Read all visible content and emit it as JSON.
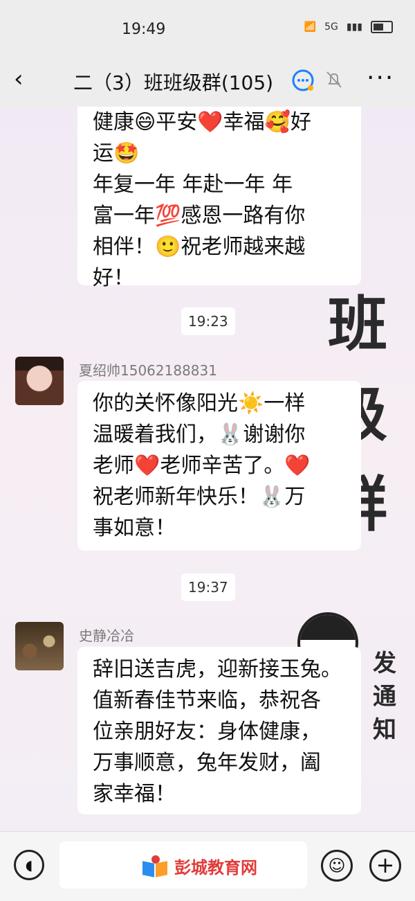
{
  "status": {
    "time": "19:49",
    "signal": "5G",
    "wifi": "6"
  },
  "header": {
    "title": "二（3）班班级群(105)"
  },
  "background": {
    "word": "班级群",
    "small": "发通知"
  },
  "messages": [
    {
      "lines": [
        "健康😄平安❤️幸福🥰好",
        "运🤩",
        "年复一年 年赴一年 年",
        "富一年💯感恩一路有你",
        "相伴！🙂祝老师越来越",
        "好！"
      ]
    },
    {
      "time": "19:23",
      "sender": "夏绍帅15062188831",
      "lines": [
        "你的关怀像阳光☀️一样",
        "温暖着我们，🐰谢谢你",
        "老师❤️老师辛苦了。❤️",
        "祝老师新年快乐！🐰万",
        "事如意！"
      ]
    },
    {
      "time": "19:37",
      "sender": "史静冾冾",
      "lines": [
        "辞旧送吉虎，迎新接玉兔。",
        "值新春佳节来临，恭祝各",
        "位亲朋好友：身体健康，",
        "万事顺意，兔年发财，阖",
        "家幸福！"
      ]
    }
  ],
  "input": {
    "watermark": "彭城教育网"
  },
  "icons": {
    "back": "back-arrow-icon",
    "chat": "group-chat-icon",
    "mute": "mute-bell-icon",
    "more": "more-icon",
    "voice": "voice-icon",
    "emoji": "emoji-icon",
    "plus": "plus-icon"
  }
}
